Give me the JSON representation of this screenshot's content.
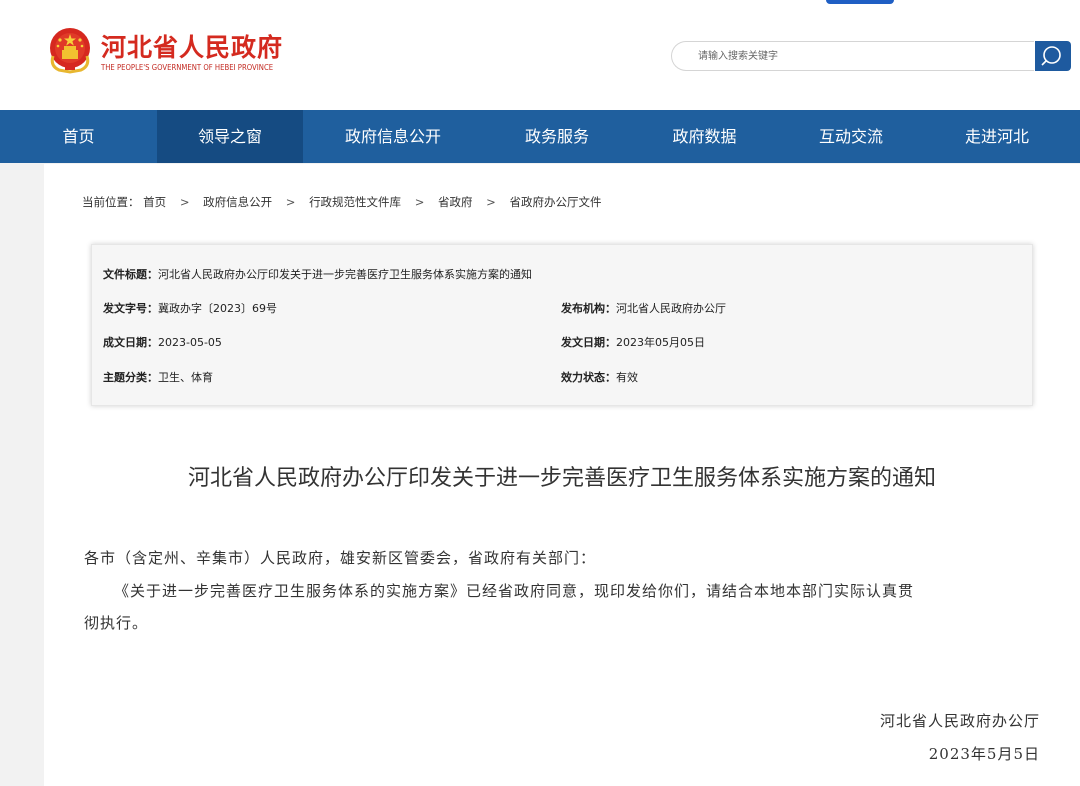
{
  "header": {
    "site_name_cn": "河北省人民政府",
    "site_name_en": "THE PEOPLE'S GOVERNMENT OF HEBEI PROVINCE",
    "emblem_icon": "national-emblem-icon",
    "search": {
      "placeholder": "请输入搜索关键字",
      "icon": "search-icon"
    }
  },
  "nav": {
    "items": [
      {
        "label": "首页"
      },
      {
        "label": "领导之窗"
      },
      {
        "label": "政府信息公开"
      },
      {
        "label": "政务服务"
      },
      {
        "label": "政府数据"
      },
      {
        "label": "互动交流"
      },
      {
        "label": "走进河北"
      }
    ],
    "active_index": 1
  },
  "breadcrumb": {
    "prefix": "当前位置：",
    "items": [
      "首页",
      "政府信息公开",
      "行政规范性文件库",
      "省政府",
      "省政府办公厅文件"
    ],
    "separator": ">"
  },
  "doc_info": {
    "title_label": "文件标题：",
    "title_value": "河北省人民政府办公厅印发关于进一步完善医疗卫生服务体系实施方案的通知",
    "number_label": "发文字号：",
    "number_value": "冀政办字〔2023〕69号",
    "issuer_label": "发布机构：",
    "issuer_value": "河北省人民政府办公厅",
    "written_date_label": "成文日期：",
    "written_date_value": "2023-05-05",
    "issue_date_label": "发文日期：",
    "issue_date_value": "2023年05月05日",
    "topic_label": "主题分类：",
    "topic_value": "卫生、体育",
    "status_label": "效力状态：",
    "status_value": "有效"
  },
  "article": {
    "title": "河北省人民政府办公厅印发关于进一步完善医疗卫生服务体系实施方案的通知",
    "addressee": "各市（含定州、辛集市）人民政府，雄安新区管委会，省政府有关部门：",
    "para1_line1": "《关于进一步完善医疗卫生服务体系的实施方案》已经省政府同意，现印发给你们，请结合本地本部门实际认真贯",
    "para1_line2": "彻执行。",
    "signer": "河北省人民政府办公厅",
    "date": "2023年5月5日"
  },
  "colors": {
    "nav_bg": "#1f5f9e",
    "nav_active": "#154b82",
    "brand_red": "#d42a1f",
    "search_button": "#1e5a9f"
  }
}
